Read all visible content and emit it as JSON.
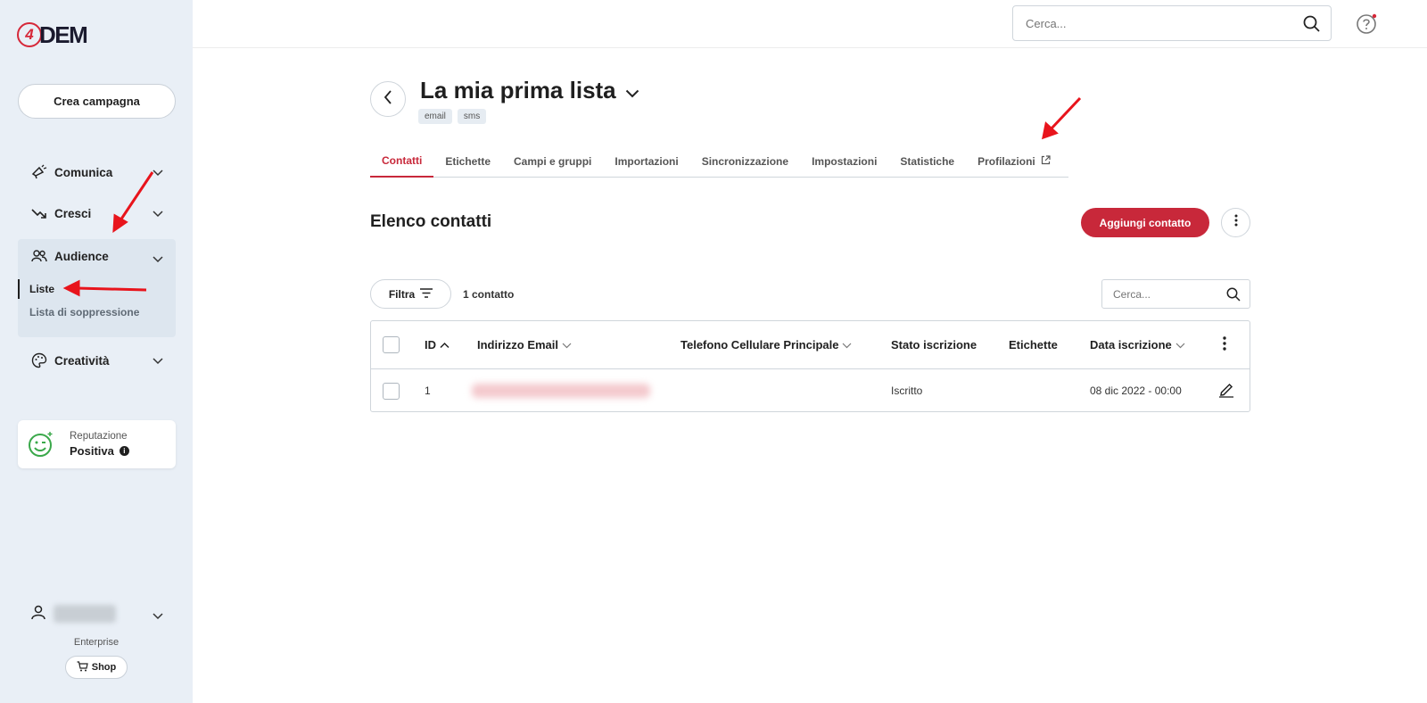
{
  "app": {
    "logo_text": "DEM",
    "logo_mark": "4"
  },
  "sidebar": {
    "create_button": "Crea campagna",
    "items": [
      {
        "label": "Comunica",
        "icon": "megaphone-icon"
      },
      {
        "label": "Cresci",
        "icon": "trend-up-icon"
      },
      {
        "label": "Audience",
        "icon": "people-icon"
      },
      {
        "label": "Creatività",
        "icon": "palette-icon"
      }
    ],
    "audience_sub": [
      {
        "label": "Liste"
      },
      {
        "label": "Lista di soppressione"
      }
    ],
    "reputation": {
      "label": "Reputazione",
      "value": "Positiva",
      "info": "i"
    },
    "plan": "Enterprise",
    "shop_button": "Shop"
  },
  "topbar": {
    "search_placeholder": "Cerca..."
  },
  "list": {
    "title": "La mia prima lista",
    "tags": [
      "email",
      "sms"
    ]
  },
  "tabs": [
    {
      "label": "Contatti",
      "active": true
    },
    {
      "label": "Etichette"
    },
    {
      "label": "Campi e gruppi"
    },
    {
      "label": "Importazioni"
    },
    {
      "label": "Sincronizzazione"
    },
    {
      "label": "Impostazioni"
    },
    {
      "label": "Statistiche"
    },
    {
      "label": "Profilazioni"
    }
  ],
  "contacts": {
    "title": "Elenco contatti",
    "add_button": "Aggiungi contatto",
    "filter_button": "Filtra",
    "count": "1 contatto",
    "search_placeholder": "Cerca...",
    "columns": [
      "ID",
      "Indirizzo Email",
      "Telefono Cellulare Principale",
      "Stato iscrizione",
      "Etichette",
      "Data iscrizione"
    ],
    "rows": [
      {
        "id": "1",
        "email": "",
        "phone": "",
        "status": "Iscritto",
        "labels": "",
        "date": "08 dic 2022 - 00:00"
      }
    ]
  },
  "colors": {
    "accent": "#c8283a",
    "sidebar_bg": "#e9eff6",
    "annotation_arrow": "#e8141c"
  }
}
